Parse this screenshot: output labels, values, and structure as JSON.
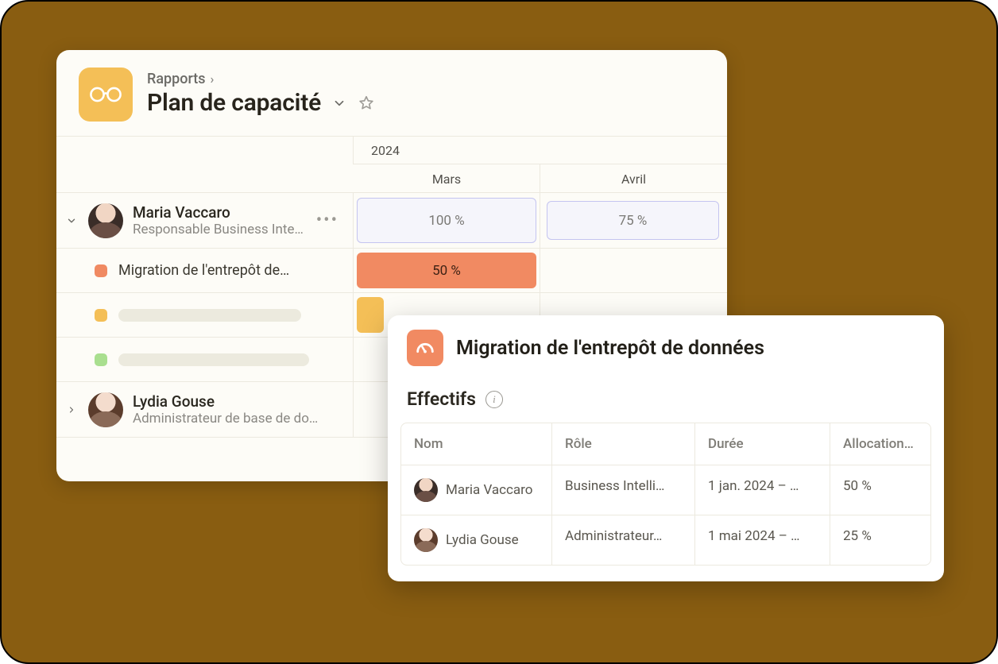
{
  "breadcrumb": {
    "root": "Rapports"
  },
  "title": "Plan de capacité",
  "timeline": {
    "year": "2024",
    "months": [
      "Mars",
      "Avril"
    ]
  },
  "people": [
    {
      "name": "Maria Vaccaro",
      "role": "Responsable Business Intelli…",
      "capacity": [
        "100 %",
        "75 %"
      ],
      "projects": [
        {
          "name": "Migration de l'entrepôt de…",
          "color": "orange",
          "alloc": "50 %"
        },
        {
          "name": "",
          "color": "yellow"
        },
        {
          "name": "",
          "color": "green"
        }
      ]
    },
    {
      "name": "Lydia Gouse",
      "role": "Administrateur de base de do…"
    }
  ],
  "detail": {
    "title": "Migration de l'entrepôt de données",
    "section": "Effectifs",
    "columns": {
      "name": "Nom",
      "role": "Rôle",
      "duration": "Durée",
      "allocation": "Allocation…"
    },
    "rows": [
      {
        "name": "Maria Vaccaro",
        "role": "Business Intelli…",
        "duration": "1 jan. 2024 – …",
        "allocation": "50 %"
      },
      {
        "name": "Lydia Gouse",
        "role": "Administrateur…",
        "duration": "1 mai 2024 – …",
        "allocation": "25 %"
      }
    ]
  }
}
